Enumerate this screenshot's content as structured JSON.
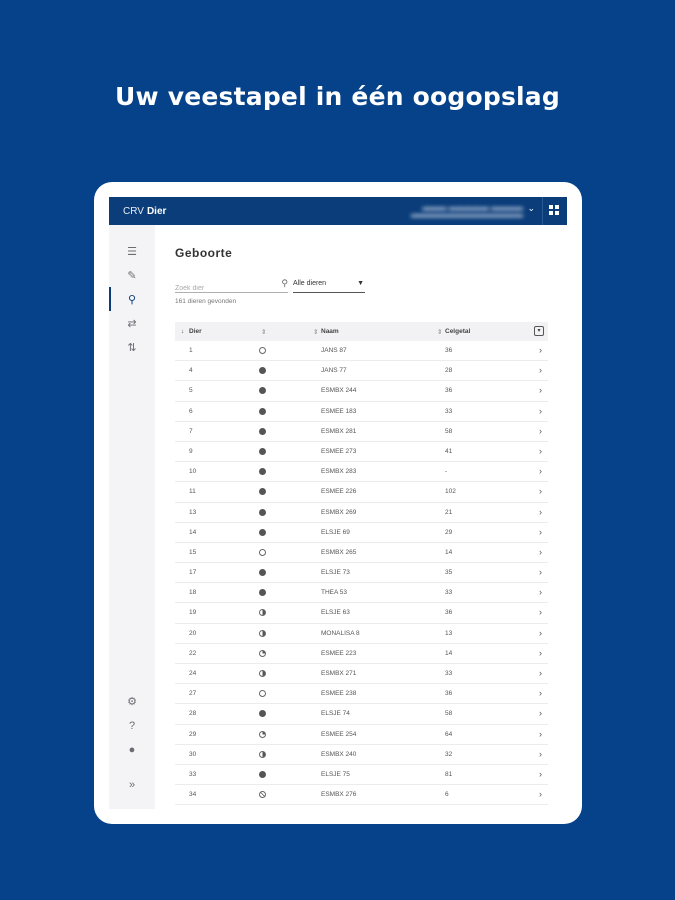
{
  "headline": "Uw veestapel in één oogopslag",
  "app": {
    "brand_prefix": "CRV",
    "brand_name": "Dier"
  },
  "page": {
    "title": "Geboorte",
    "search_placeholder": "Zoek dier",
    "filter_selected": "Alle dieren",
    "found_text": "161 dieren gevonden"
  },
  "table": {
    "headers": {
      "dier": "Dier",
      "naam": "Naam",
      "celgetal": "Celgetal"
    },
    "rows": [
      {
        "dier": "1",
        "status": "ring",
        "naam": "JANS 87",
        "celgetal": "36"
      },
      {
        "dier": "4",
        "status": "full",
        "naam": "JANS 77",
        "celgetal": "28"
      },
      {
        "dier": "5",
        "status": "full",
        "naam": "ESMBX 244",
        "celgetal": "36"
      },
      {
        "dier": "6",
        "status": "full",
        "naam": "ESMEE 183",
        "celgetal": "33"
      },
      {
        "dier": "7",
        "status": "full",
        "naam": "ESMBX 281",
        "celgetal": "58"
      },
      {
        "dier": "9",
        "status": "full",
        "naam": "ESMEE 273",
        "celgetal": "41"
      },
      {
        "dier": "10",
        "status": "full",
        "naam": "ESMBX 283",
        "celgetal": "-"
      },
      {
        "dier": "11",
        "status": "full",
        "naam": "ESMEE 226",
        "celgetal": "102"
      },
      {
        "dier": "13",
        "status": "full",
        "naam": "ESMBX 269",
        "celgetal": "21"
      },
      {
        "dier": "14",
        "status": "full",
        "naam": "ELSJE 69",
        "celgetal": "29"
      },
      {
        "dier": "15",
        "status": "ring",
        "naam": "ESMBX 265",
        "celgetal": "14"
      },
      {
        "dier": "17",
        "status": "full",
        "naam": "ELSJE 73",
        "celgetal": "35"
      },
      {
        "dier": "18",
        "status": "full",
        "naam": "THEA 53",
        "celgetal": "33"
      },
      {
        "dier": "19",
        "status": "half",
        "naam": "ELSJE 63",
        "celgetal": "36"
      },
      {
        "dier": "20",
        "status": "half",
        "naam": "MONALISA 8",
        "celgetal": "13"
      },
      {
        "dier": "22",
        "status": "quarter",
        "naam": "ESMEE 223",
        "celgetal": "14"
      },
      {
        "dier": "24",
        "status": "half",
        "naam": "ESMBX 271",
        "celgetal": "33"
      },
      {
        "dier": "27",
        "status": "ring",
        "naam": "ESMEE 238",
        "celgetal": "36"
      },
      {
        "dier": "28",
        "status": "full",
        "naam": "ELSJE 74",
        "celgetal": "58"
      },
      {
        "dier": "29",
        "status": "quarter",
        "naam": "ESMEE 254",
        "celgetal": "64"
      },
      {
        "dier": "30",
        "status": "half",
        "naam": "ESMBX 240",
        "celgetal": "32"
      },
      {
        "dier": "33",
        "status": "full",
        "naam": "ELSJE 75",
        "celgetal": "81"
      },
      {
        "dier": "34",
        "status": "blocked",
        "naam": "ESMBX 276",
        "celgetal": "6"
      }
    ]
  },
  "icons": {
    "sidebar": [
      "list-icon",
      "pencil-icon",
      "search-icon",
      "transfer-icon",
      "sort-icon"
    ],
    "sidebar_bottom": [
      "gear-icon",
      "help-icon",
      "chat-icon",
      "expand-icon"
    ]
  },
  "colors": {
    "background": "#05428a",
    "topbar": "#0b3d7a"
  }
}
